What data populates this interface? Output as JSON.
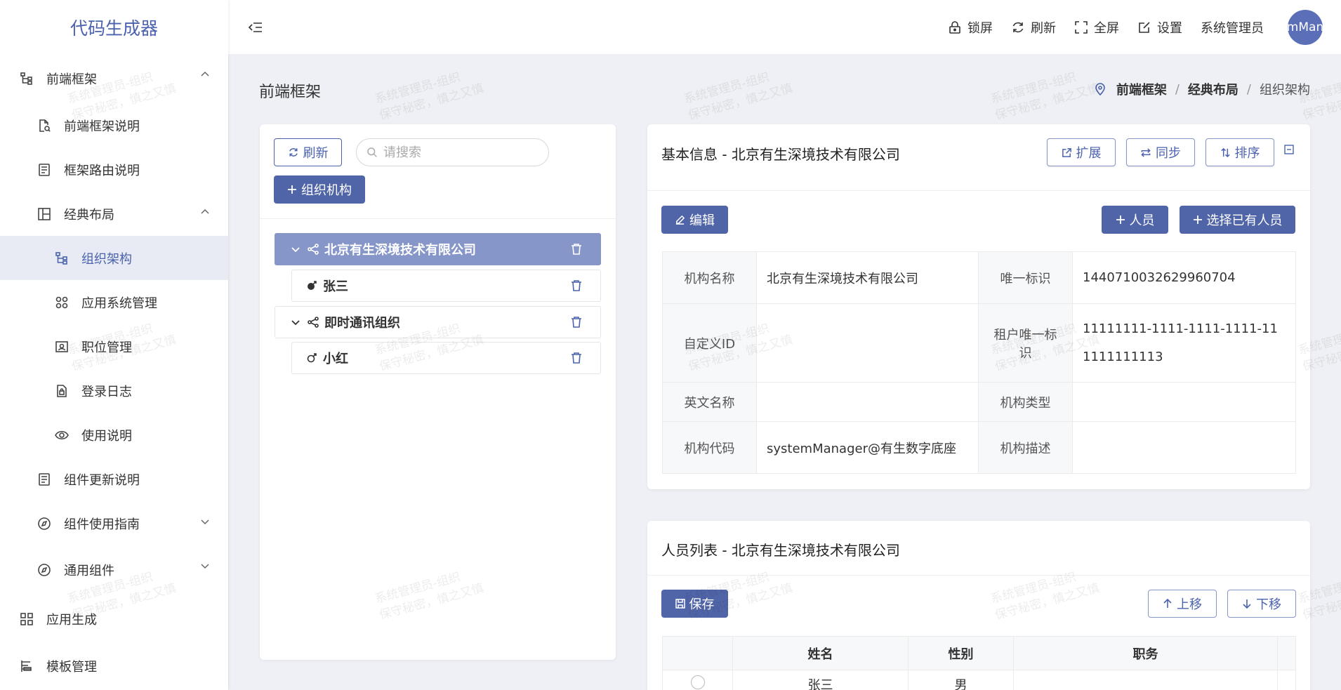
{
  "app": {
    "title": "代码生成器"
  },
  "sidebar": {
    "items": [
      {
        "label": "前端框架",
        "icon": "org-tree-icon"
      },
      {
        "label": "前端框架说明",
        "icon": "doc-search-icon"
      },
      {
        "label": "框架路由说明",
        "icon": "list-doc-icon"
      },
      {
        "label": "经典布局",
        "icon": "layout-icon"
      },
      {
        "label": "组织架构",
        "icon": "org-tree-icon"
      },
      {
        "label": "应用系统管理",
        "icon": "grid-icon"
      },
      {
        "label": "职位管理",
        "icon": "id-card-icon"
      },
      {
        "label": "登录日志",
        "icon": "lock-doc-icon"
      },
      {
        "label": "使用说明",
        "icon": "eye-icon"
      },
      {
        "label": "组件更新说明",
        "icon": "list-doc-icon"
      },
      {
        "label": "组件使用指南",
        "icon": "compass-icon"
      },
      {
        "label": "通用组件",
        "icon": "compass-icon"
      },
      {
        "label": "应用生成",
        "icon": "grid-icon"
      },
      {
        "label": "模板管理",
        "icon": "template-icon"
      }
    ]
  },
  "header": {
    "lock": "锁屏",
    "refresh": "刷新",
    "fullscreen": "全屏",
    "settings": "设置",
    "user": "系统管理员",
    "avatar_text": "mMan"
  },
  "page": {
    "title": "前端框架",
    "breadcrumb": [
      "前端框架",
      "经典布局",
      "组织架构"
    ]
  },
  "tree_panel": {
    "refresh_label": "刷新",
    "search_placeholder": "请搜索",
    "add_org_label": "组织机构",
    "nodes": [
      {
        "label": "北京有生深境技术有限公司",
        "type": "org",
        "selected": true
      },
      {
        "label": "张三",
        "type": "female"
      },
      {
        "label": "即时通讯组织",
        "type": "org"
      },
      {
        "label": "小红",
        "type": "male"
      }
    ]
  },
  "info_card": {
    "title": "基本信息 - 北京有生深境技术有限公司",
    "expand_label": "扩展",
    "sync_label": "同步",
    "sort_label": "排序",
    "edit_label": "编辑",
    "add_person_label": "人员",
    "select_person_label": "选择已有人员",
    "fields": {
      "org_name_label": "机构名称",
      "org_name": "北京有生深境技术有限公司",
      "unique_id_label": "唯一标识",
      "unique_id": "1440710032629960704",
      "custom_id_label": "自定义ID",
      "custom_id": "",
      "tenant_id_label": "租户唯一标识",
      "tenant_id": "11111111-1111-1111-1111-111111111113",
      "english_name_label": "英文名称",
      "english_name": "",
      "org_type_label": "机构类型",
      "org_type": "",
      "org_code_label": "机构代码",
      "org_code": "systemManager@有生数字底座",
      "org_desc_label": "机构描述",
      "org_desc": ""
    }
  },
  "people_card": {
    "title": "人员列表 - 北京有生深境技术有限公司",
    "save_label": "保存",
    "up_label": "上移",
    "down_label": "下移",
    "columns": [
      "姓名",
      "性别",
      "职务"
    ],
    "rows": [
      {
        "name": "张三",
        "gender": "男",
        "title": ""
      }
    ]
  },
  "watermark": {
    "line1": "系统管理员-组织",
    "line2": "保守秘密，慎之又慎"
  },
  "colors": {
    "primary": "#4b63ae",
    "selected_node": "#8796c9",
    "background": "#eef0f5"
  }
}
